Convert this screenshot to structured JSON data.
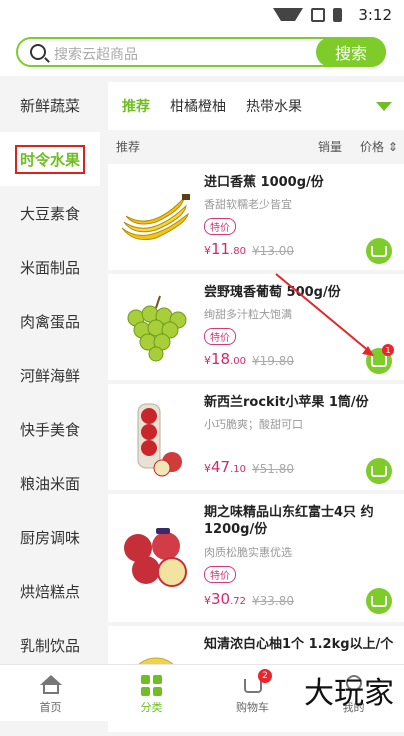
{
  "status_bar": {
    "time": "3:12",
    "icons": [
      "wifi-icon",
      "no-signal-icon",
      "battery-icon"
    ]
  },
  "search": {
    "placeholder": "搜索云超商品",
    "button_label": "搜索"
  },
  "sidebar": {
    "items": [
      {
        "label": "新鲜蔬菜",
        "active": false
      },
      {
        "label": "时令水果",
        "active": true
      },
      {
        "label": "大豆素食",
        "active": false
      },
      {
        "label": "米面制品",
        "active": false
      },
      {
        "label": "肉禽蛋品",
        "active": false
      },
      {
        "label": "河鲜海鲜",
        "active": false
      },
      {
        "label": "快手美食",
        "active": false
      },
      {
        "label": "粮油米面",
        "active": false
      },
      {
        "label": "厨房调味",
        "active": false
      },
      {
        "label": "烘焙糕点",
        "active": false
      },
      {
        "label": "乳制饮品",
        "active": false
      }
    ]
  },
  "category_tabs": [
    {
      "label": "推荐",
      "active": true
    },
    {
      "label": "柑橘橙柚",
      "active": false
    },
    {
      "label": "热带水果",
      "active": false
    }
  ],
  "sort_bar": {
    "recommend": "推荐",
    "sales": "销量",
    "price": "价格"
  },
  "products": [
    {
      "title": "进口香蕉 1000g/份",
      "subtitle": "香甜软糯老少皆宜",
      "tag": "特价",
      "currency": "¥",
      "price_int": "11",
      "price_dec": ".80",
      "orig": "¥13.00",
      "cart_count": ""
    },
    {
      "title": "尝野瑰香葡萄 500g/份",
      "subtitle": "绚甜多汁粒大饱满",
      "tag": "特价",
      "currency": "¥",
      "price_int": "18",
      "price_dec": ".00",
      "orig": "¥19.80",
      "cart_count": "1"
    },
    {
      "title": "新西兰rockit小苹果 1筒/份",
      "subtitle": "小巧脆爽；酸甜可口",
      "tag": "",
      "currency": "¥",
      "price_int": "47",
      "price_dec": ".10",
      "orig": "¥51.80",
      "cart_count": ""
    },
    {
      "title": "期之味精品山东红富士4只 约1200g/份",
      "subtitle": "肉质松脆实惠优选",
      "tag": "特价",
      "currency": "¥",
      "price_int": "30",
      "price_dec": ".72",
      "orig": "¥33.80",
      "cart_count": ""
    },
    {
      "title": "知清浓白心柚1个 1.2kg以上/个",
      "subtitle": "",
      "tag": "",
      "currency": "",
      "price_int": "",
      "price_dec": "",
      "orig": "",
      "cart_count": ""
    }
  ],
  "bottom_nav": [
    {
      "label": "首页",
      "icon": "home-icon",
      "active": false
    },
    {
      "label": "分类",
      "icon": "category-icon",
      "active": true
    },
    {
      "label": "购物车",
      "icon": "cart-icon",
      "active": false,
      "badge": "2"
    },
    {
      "label": "我的",
      "icon": "user-icon",
      "active": false
    }
  ],
  "watermark": "大玩家",
  "colors": {
    "accent": "#7ecc2a",
    "price": "#d4286b",
    "highlight_box": "#d9231d",
    "badge": "#e8262b"
  }
}
